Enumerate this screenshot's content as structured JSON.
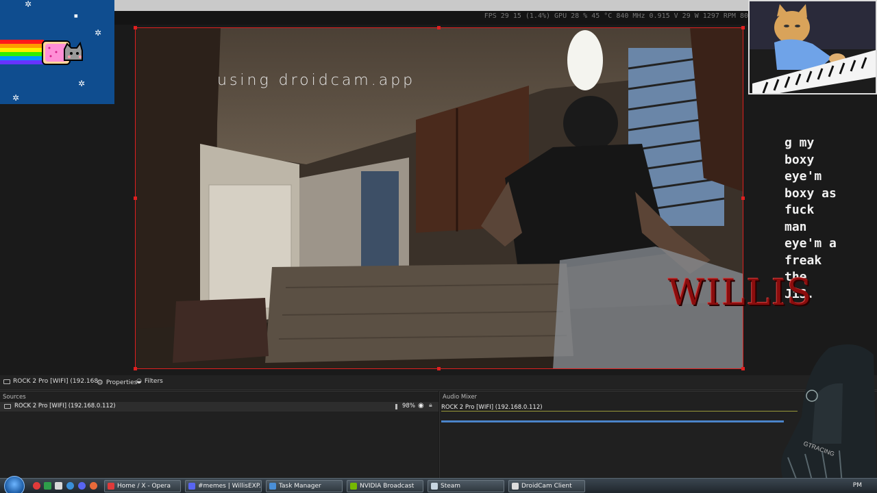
{
  "preview": {
    "stats": "FPS  29    15 (1.4%)   GPU  28 %  45 °C  840 MHz  0.915 V  29 W  1297 RPM  80",
    "watermark": "using droidcam.app"
  },
  "overlay": {
    "lyrics": [
      "g my",
      "boxy",
      "eye'm",
      "boxy as",
      "fuck",
      "man",
      "eye'm a",
      "freak",
      "the",
      "JiS."
    ],
    "logo_text": "WILLIS"
  },
  "source_toolbar": {
    "source_name": "ROCK 2 Pro [WIFI] (192.168",
    "properties_label": "Properties",
    "filters_label": "Filters"
  },
  "sources_panel": {
    "title": "Sources",
    "items": [
      {
        "name": "ROCK 2 Pro [WIFI] (192.168.0.112)",
        "opacity": "98%"
      }
    ]
  },
  "audio_mixer": {
    "title": "Audio Mixer",
    "track_name": "ROCK 2 Pro [WIFI] (192.168.0.112)"
  },
  "taskbar": {
    "tasks": [
      {
        "label": "Home / X - Opera",
        "icon_color": "#e03a3a"
      },
      {
        "label": "#memes | WillisEXP...",
        "icon_color": "#5865f2"
      },
      {
        "label": "Task Manager",
        "icon_color": "#4a8fd8"
      },
      {
        "label": "NVIDIA Broadcast",
        "icon_color": "#76b900"
      },
      {
        "label": "Steam",
        "icon_color": "#c7d5e0"
      },
      {
        "label": "DroidCam Client",
        "icon_color": "#dddddd"
      }
    ],
    "clock": "PM"
  },
  "colors": {
    "selection_border": "#e02020",
    "fader": "#4b84c9",
    "logo": "#8b0d0d"
  }
}
